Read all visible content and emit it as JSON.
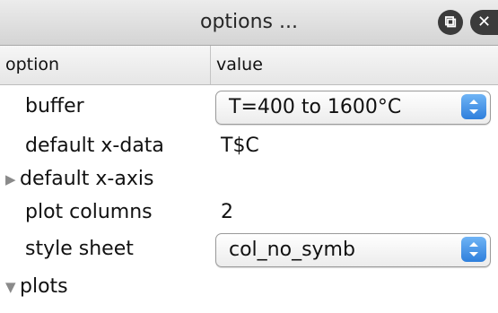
{
  "window": {
    "title": "options ..."
  },
  "table": {
    "headers": {
      "option": "option",
      "value": "value"
    },
    "rows": {
      "buffer": {
        "label": "buffer",
        "value": "T=400 to 1600°C"
      },
      "default_x_data": {
        "label": "default x-data",
        "value": "T$C"
      },
      "default_x_axis": {
        "label": "default x-axis"
      },
      "plot_columns": {
        "label": "plot columns",
        "value": "2"
      },
      "style_sheet": {
        "label": "style sheet",
        "value": "col_no_symb"
      },
      "plots": {
        "label": "plots"
      }
    }
  },
  "icons": {
    "float": "float-window-icon",
    "close": "close-icon",
    "collapsed": "disclosure-collapsed-icon",
    "expanded": "disclosure-expanded-icon",
    "stepper": "stepper-icon"
  },
  "colors": {
    "stepper_accent": "#3a8ae6",
    "titlebar": "#dcdcdc"
  }
}
